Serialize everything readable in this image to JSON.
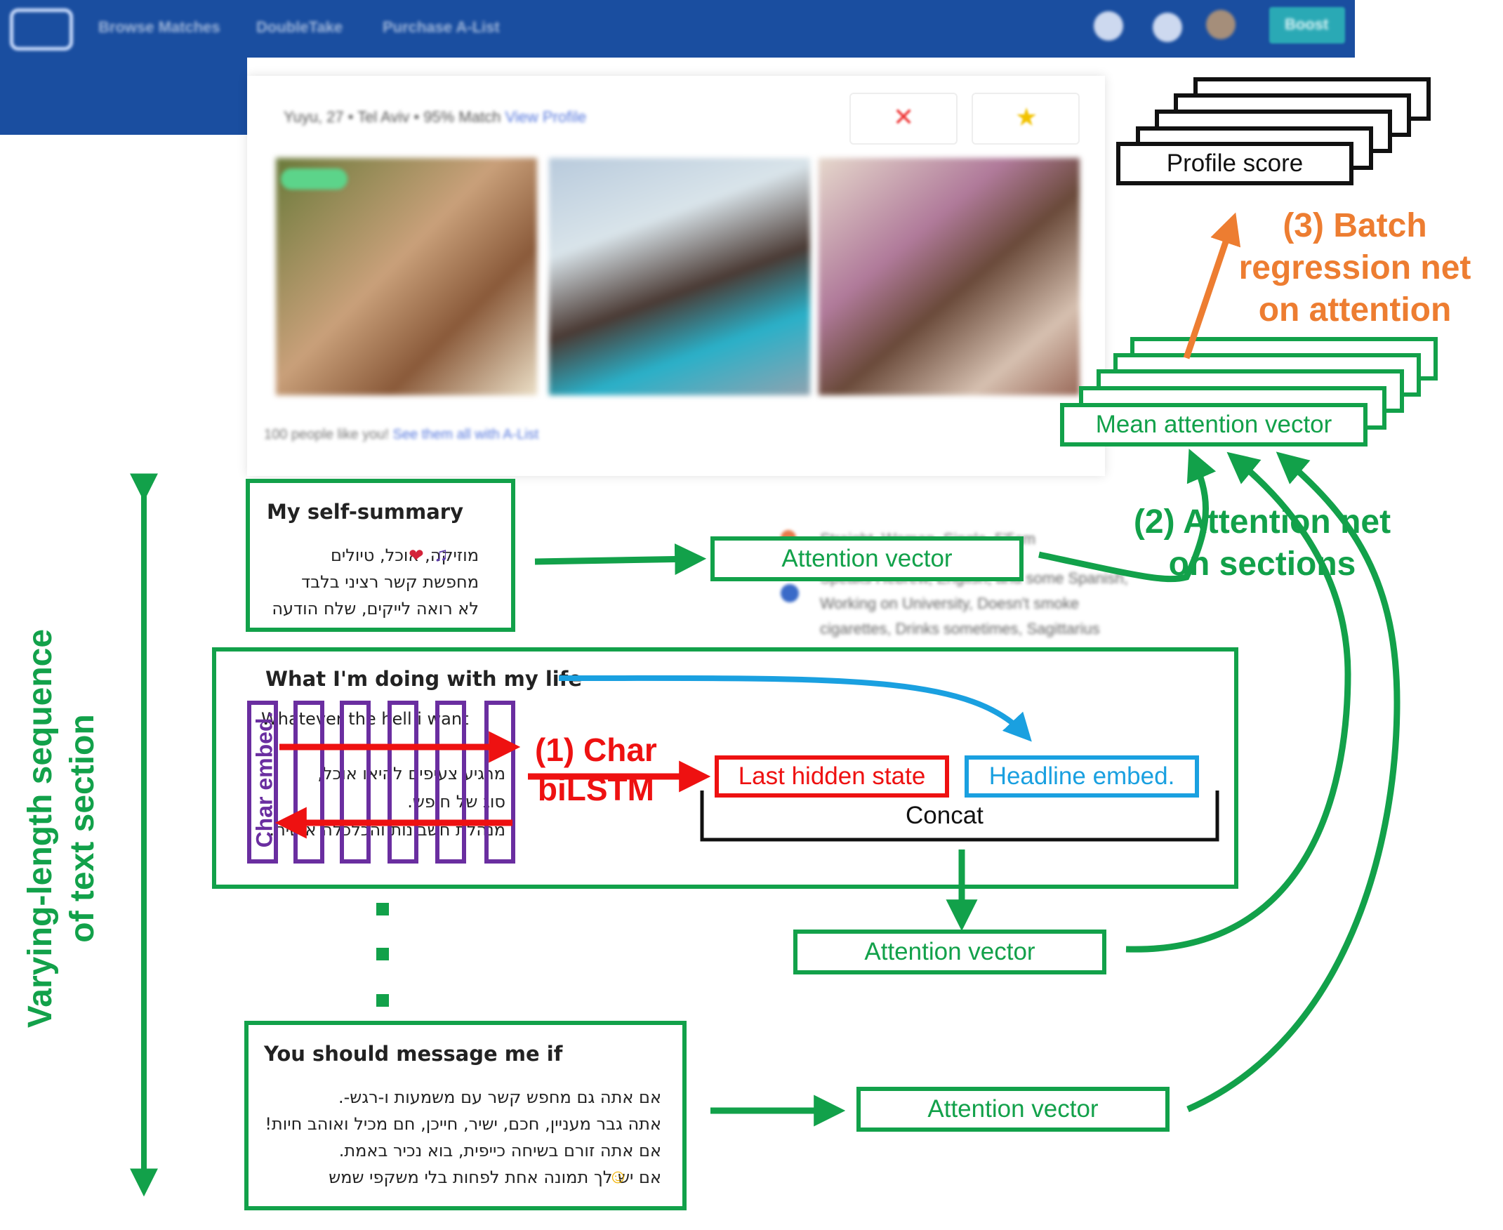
{
  "nav": {
    "items": [
      "Browse Matches",
      "DoubleTake",
      "Purchase A-List"
    ],
    "boost_label": "Boost"
  },
  "profile_card": {
    "header_text": "Yuyu, 27 • Tel Aviv • 95% Match",
    "view_profile": "View Profile",
    "likes_text": "100 people like you!",
    "likes_link": "See them all with A-List"
  },
  "side_details": {
    "line1": "Straight, Woman, Single, 5'5cm",
    "line2": "Speaks Hebrew, English, and some Spanish, Working on University, Doesn't smoke cigarettes, Drinks sometimes, Sagittarius"
  },
  "sections": {
    "self_summary": {
      "title": "My self-summary",
      "lines": [
        "מוזיקה, אוכל, טיולים",
        "מחפשת קשר רציני בלבד",
        "לא רואה לייקים, שלח הודעה"
      ]
    },
    "doing": {
      "title": "What I'm doing with my life",
      "lines": [
        "Whatever the hell i want",
        "מרגיע צעיפים להיאו אוכל,",
        "סוג של חופש.",
        "מנהלת חשבונות והכלכלה אישית."
      ]
    },
    "message": {
      "title": "You should message me if",
      "lines": [
        "אם אתה גם מחפש קשר עם משמעות ו-רגש-.",
        "אתה גבר מעניין, חכם, ישיר, חייכן, חם מכיל ואוהב חיות!",
        "אם אתה זורם בשיחה כייפית, בוא נכיר באמת.",
        "אם יש לך תמונה אחת לפחות בלי משקפי שמש"
      ]
    }
  },
  "diagram": {
    "attention_vector": "Attention vector",
    "mean_attention_vector": "Mean attention vector",
    "profile_score": "Profile score",
    "char_bilstm": [
      "(1) Char",
      "biLSTM"
    ],
    "attention_net": [
      "(2) Attention net",
      "on sections"
    ],
    "batch_regression": [
      "(3) Batch",
      "regression net",
      "on attention"
    ],
    "last_hidden_state": "Last hidden state",
    "headline_embed": "Headline embed.",
    "concat": "Concat",
    "char_embed": "Char embed.",
    "varying_length": [
      "Varying-length sequence",
      "of text section"
    ]
  },
  "colors": {
    "green": "#12a14a",
    "red": "#ee1111",
    "blue": "#1aa0e0",
    "orange": "#ed7d31",
    "purple": "#6a2ea0",
    "nav_blue": "#1a4ea0"
  }
}
